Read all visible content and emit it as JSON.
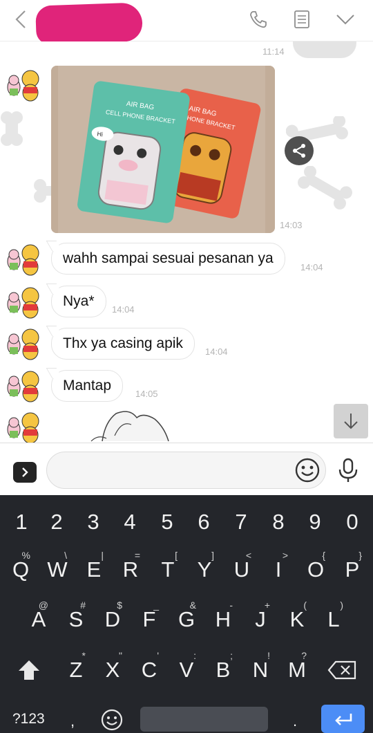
{
  "header": {
    "contact_name_redacted": true,
    "icons": [
      "back-chevron-icon",
      "phone-icon",
      "notes-icon",
      "chevron-down-icon"
    ]
  },
  "chat": {
    "sent_partial_time": "11:14",
    "photo_message": {
      "time": "14:03",
      "labels": [
        "AIR BAG",
        "CELL PHONE BRACKET",
        "AIR BAG",
        "PHONE BRACKET",
        "Hi"
      ]
    },
    "messages": [
      {
        "text": "wahh sampai sesuai pesanan ya",
        "time": "14:04"
      },
      {
        "text": "Nya*",
        "time": "14:04"
      },
      {
        "text": "Thx ya casing apik",
        "time": "14:04"
      },
      {
        "text": "Mantap",
        "time": "14:05"
      }
    ]
  },
  "input": {
    "placeholder": "",
    "icons": [
      "expand-arrow-icon",
      "emoji-icon",
      "mic-icon"
    ]
  },
  "keyboard": {
    "numbers": [
      "1",
      "2",
      "3",
      "4",
      "5",
      "6",
      "7",
      "8",
      "9",
      "0"
    ],
    "row1": [
      [
        "Q",
        "%"
      ],
      [
        "W",
        "\\"
      ],
      [
        "E",
        "|"
      ],
      [
        "R",
        "="
      ],
      [
        "T",
        "["
      ],
      [
        "Y",
        "]"
      ],
      [
        "U",
        "<"
      ],
      [
        "I",
        ">"
      ],
      [
        "O",
        "{"
      ],
      [
        "P",
        "}"
      ]
    ],
    "row2": [
      [
        "A",
        "@"
      ],
      [
        "S",
        "#"
      ],
      [
        "D",
        "$"
      ],
      [
        "F",
        "_"
      ],
      [
        "G",
        "&"
      ],
      [
        "H",
        "-"
      ],
      [
        "J",
        "+"
      ],
      [
        "K",
        "("
      ],
      [
        "L",
        ")"
      ]
    ],
    "row3": [
      [
        "Z",
        "*"
      ],
      [
        "X",
        "\""
      ],
      [
        "C",
        "'"
      ],
      [
        "V",
        ":"
      ],
      [
        "B",
        ";"
      ],
      [
        "N",
        "!"
      ],
      [
        "M",
        "?"
      ]
    ],
    "symbols_key": "?123",
    "comma_key": ",",
    "period_key": ".",
    "accent_color": "#4c8df6"
  }
}
